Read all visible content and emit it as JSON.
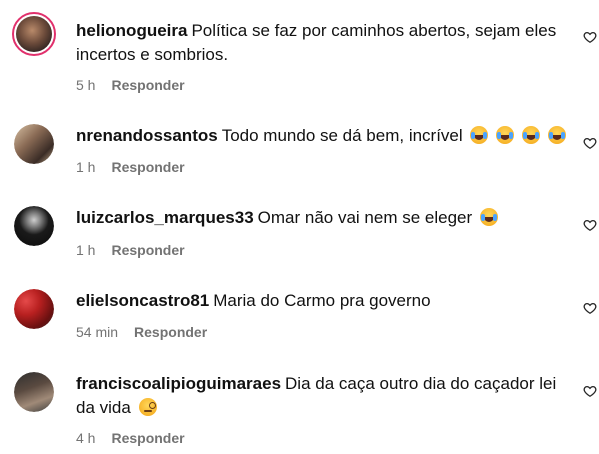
{
  "comments": [
    {
      "username": "helionogueira",
      "text": "Política se faz por caminhos abertos, sejam eles incertos e sombrios.",
      "time": "5 h",
      "reply_label": "Responder",
      "avatar_icon": "user-avatar-photo",
      "has_story_ring": true
    },
    {
      "username": "nrenandossantos",
      "text": "Todo mundo se dá bem, incrível",
      "emojis": [
        "face-with-tears-of-joy",
        "face-with-tears-of-joy",
        "face-with-tears-of-joy",
        "face-with-tears-of-joy"
      ],
      "time": "1 h",
      "reply_label": "Responder",
      "avatar_icon": "user-avatar-photo"
    },
    {
      "username": "luizcarlos_marques33",
      "text": "Omar não vai nem se eleger",
      "emojis": [
        "face-with-tears-of-joy"
      ],
      "time": "1 h",
      "reply_label": "Responder",
      "avatar_icon": "user-avatar-photo"
    },
    {
      "username": "elielsoncastro81",
      "text": "Maria do Carmo pra governo",
      "time": "54 min",
      "reply_label": "Responder",
      "avatar_icon": "user-avatar-photo"
    },
    {
      "username": "franciscoalipioguimaraes",
      "text": "Dia da caça outro dia do caçador lei da vida",
      "emojis": [
        "face-with-monocle"
      ],
      "time": "4 h",
      "reply_label": "Responder",
      "avatar_icon": "user-avatar-photo"
    }
  ],
  "colors": {
    "meta_text": "#737373",
    "story_ring": "#e1306c"
  }
}
